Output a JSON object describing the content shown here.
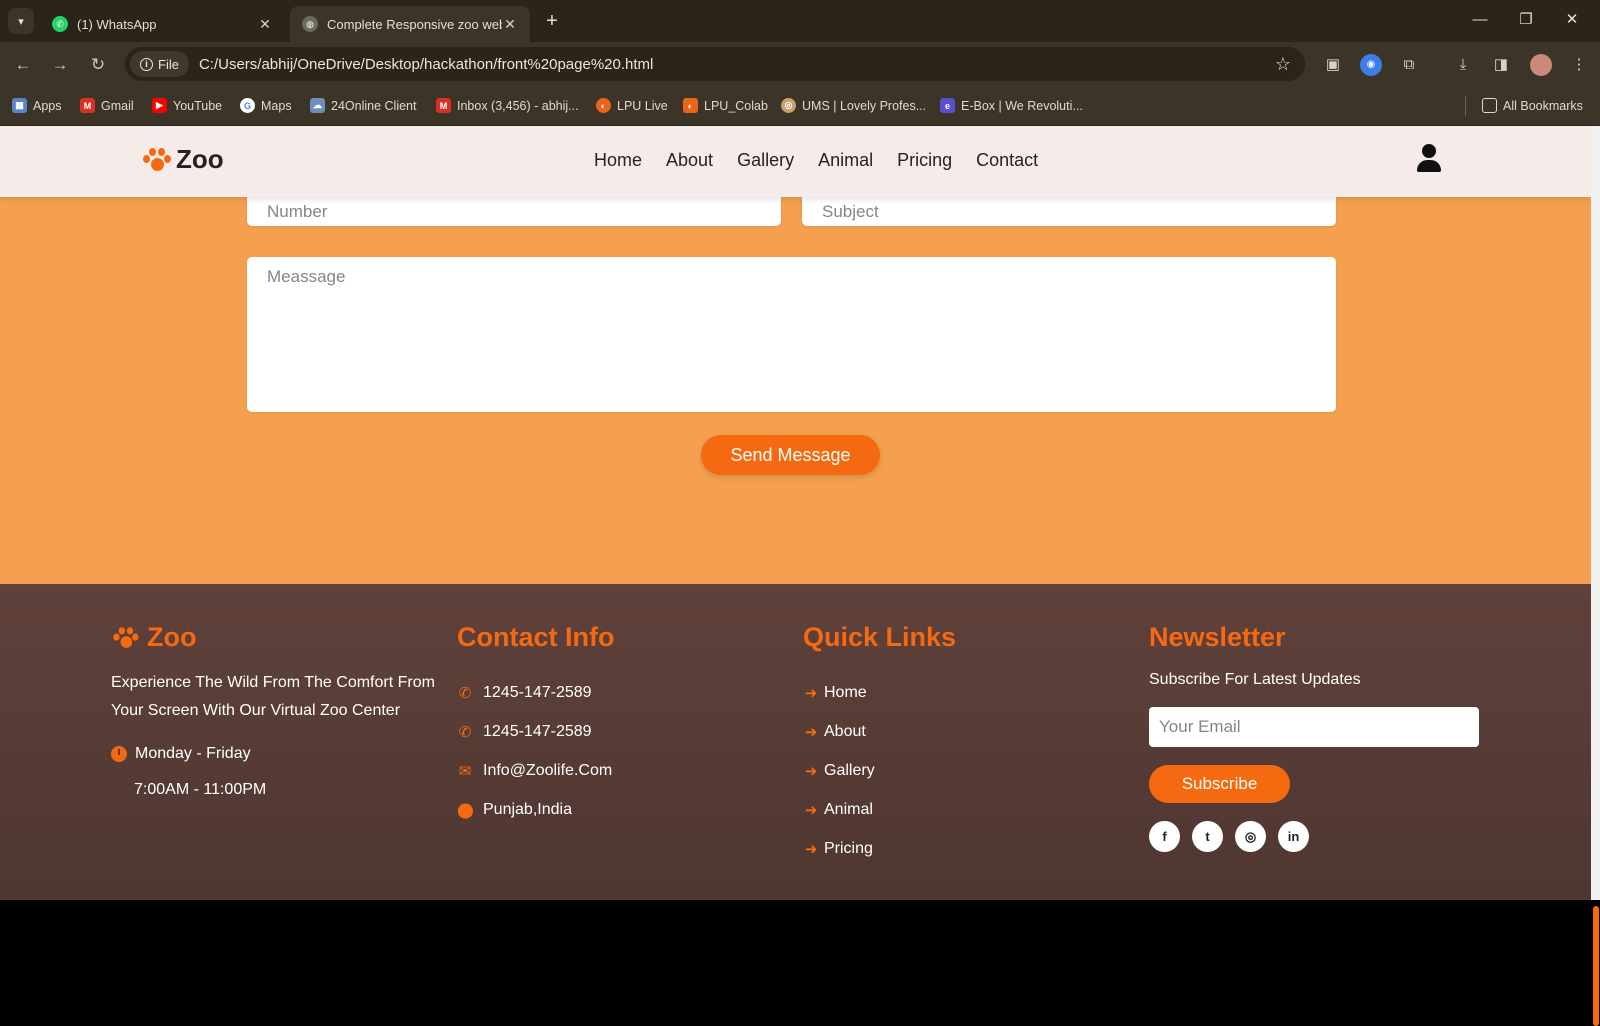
{
  "browser": {
    "tabs": [
      {
        "label": "(1) WhatsApp",
        "active": false
      },
      {
        "label": "Complete Responsive zoo webs",
        "active": true
      }
    ],
    "file_chip": "File",
    "url": "C:/Users/abhij/OneDrive/Desktop/hackathon/front%20page%20.html",
    "bookmarks": [
      "Apps",
      "Gmail",
      "YouTube",
      "Maps",
      "24Online Client",
      "Inbox (3,456) - abhij...",
      "LPU Live",
      "LPU_Colab",
      "UMS | Lovely Profes...",
      "E-Box | We Revoluti..."
    ],
    "all_bookmarks": "All Bookmarks"
  },
  "site": {
    "logo": "Zoo",
    "nav": [
      "Home",
      "About",
      "Gallery",
      "Animal",
      "Pricing",
      "Contact"
    ],
    "accent_color": "#f56a10"
  },
  "form": {
    "number_placeholder": "Number",
    "subject_placeholder": "Subject",
    "message_placeholder": "Meassage",
    "send_label": "Send Message"
  },
  "footer": {
    "brand": {
      "title": "Zoo",
      "description": "Experience The Wild From The Comfort From Your Screen With Our Virtual Zoo Center",
      "days": "Monday - Friday",
      "hours": "7:00AM - 11:00PM"
    },
    "contact": {
      "title": "Contact Info",
      "items": [
        "1245-147-2589",
        "1245-147-2589",
        "Info@Zoolife.Com",
        "Punjab,India"
      ]
    },
    "quick_links": {
      "title": "Quick Links",
      "items": [
        "Home",
        "About",
        "Gallery",
        "Animal",
        "Pricing"
      ]
    },
    "newsletter": {
      "title": "Newsletter",
      "text": "Subscribe For Latest Updates",
      "email_placeholder": "Your Email",
      "button": "Subscribe",
      "socials": [
        "facebook-icon",
        "twitter-icon",
        "instagram-icon",
        "linkedin-icon"
      ]
    }
  }
}
